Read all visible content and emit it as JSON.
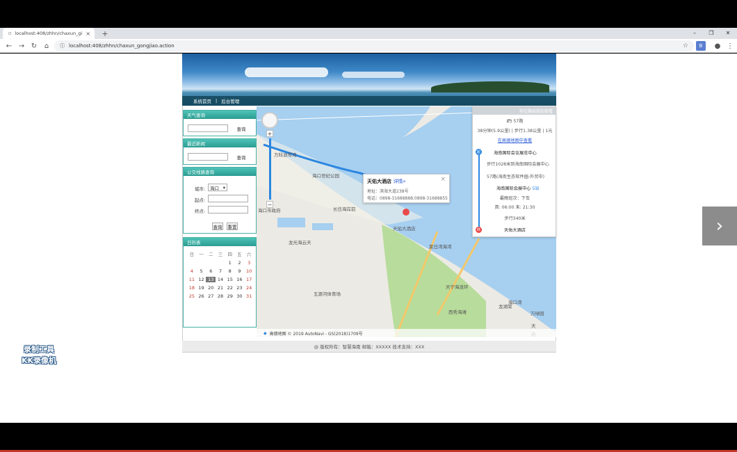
{
  "browser": {
    "tab_title": "localhost:408/zhhn/chaxun_gi",
    "url": "localhost:408/zhhn/chaxun_gongjiao.action"
  },
  "banner_nav": {
    "home": "系统首页",
    "separator": "|",
    "admin": "后台管理"
  },
  "weather": {
    "title": "天气查询",
    "button": "查询"
  },
  "news": {
    "title": "最近新闻",
    "button": "查询"
  },
  "transit": {
    "title": "公交线路查询",
    "city_label": "城市:",
    "city_value": "海口",
    "start_label": "起点:",
    "end_label": "终点:",
    "query_button": "查询",
    "reset_button": "重置"
  },
  "calendar": {
    "title": "日历表",
    "weekdays": [
      "日",
      "一",
      "二",
      "三",
      "四",
      "五",
      "六"
    ],
    "days": [
      "",
      "",
      "",
      "",
      "1",
      "2",
      "3",
      "4",
      "5",
      "6",
      "7",
      "8",
      "9",
      "10",
      "11",
      "12",
      "13",
      "14",
      "15",
      "16",
      "17",
      "18",
      "19",
      "20",
      "21",
      "22",
      "23",
      "24",
      "25",
      "26",
      "27",
      "28",
      "29",
      "30",
      "31",
      ""
    ],
    "today": "13"
  },
  "route_panel": {
    "header": "前往路线规划查看",
    "bus": "57路",
    "summary": "38分钟(5.9公里) | 步行1.38公里 | 1元",
    "link": "在高德地图中查看",
    "origin": "海南国际会议展览中心",
    "walk1": "步行1028米到海南国际会展中心",
    "line": "57路(海南生态软件园-外贸中)",
    "station": "海南国际会展中心",
    "stops": "5站",
    "last_bus": "最晚班次：下车",
    "hours": "首: 06:00 末: 21:30",
    "walk2": "步行340米",
    "destination": "天佑大酒店"
  },
  "info_window": {
    "name": "天佑大酒店",
    "detail_link": "详情»",
    "address": "地址：滨海大道238号",
    "phone": "电话：0898-31688888;0898-31688855",
    "close": "×"
  },
  "map": {
    "labels": [
      "万科浪琴湾",
      "海口世纪公园",
      "海口市政府",
      "龙光海云天",
      "五源河体育场",
      "天佑大酒店",
      "长信海岸前",
      "紫日湾海湾",
      "天宁海浪环",
      "龙湖荣",
      "西秀海滩",
      "海口湾",
      "万绿园",
      "天",
      "府"
    ],
    "zoom_in": "+",
    "zoom_out": "−",
    "attribution": "高德地图 © 2019 AutoNavi - GS(2018)1709号"
  },
  "footer": {
    "text": "@ 版权所有：智慧海南    邮箱：XXXXX    技术支持：XXX"
  },
  "watermark": {
    "line1": "录制工具",
    "line2": "KK录像机"
  }
}
